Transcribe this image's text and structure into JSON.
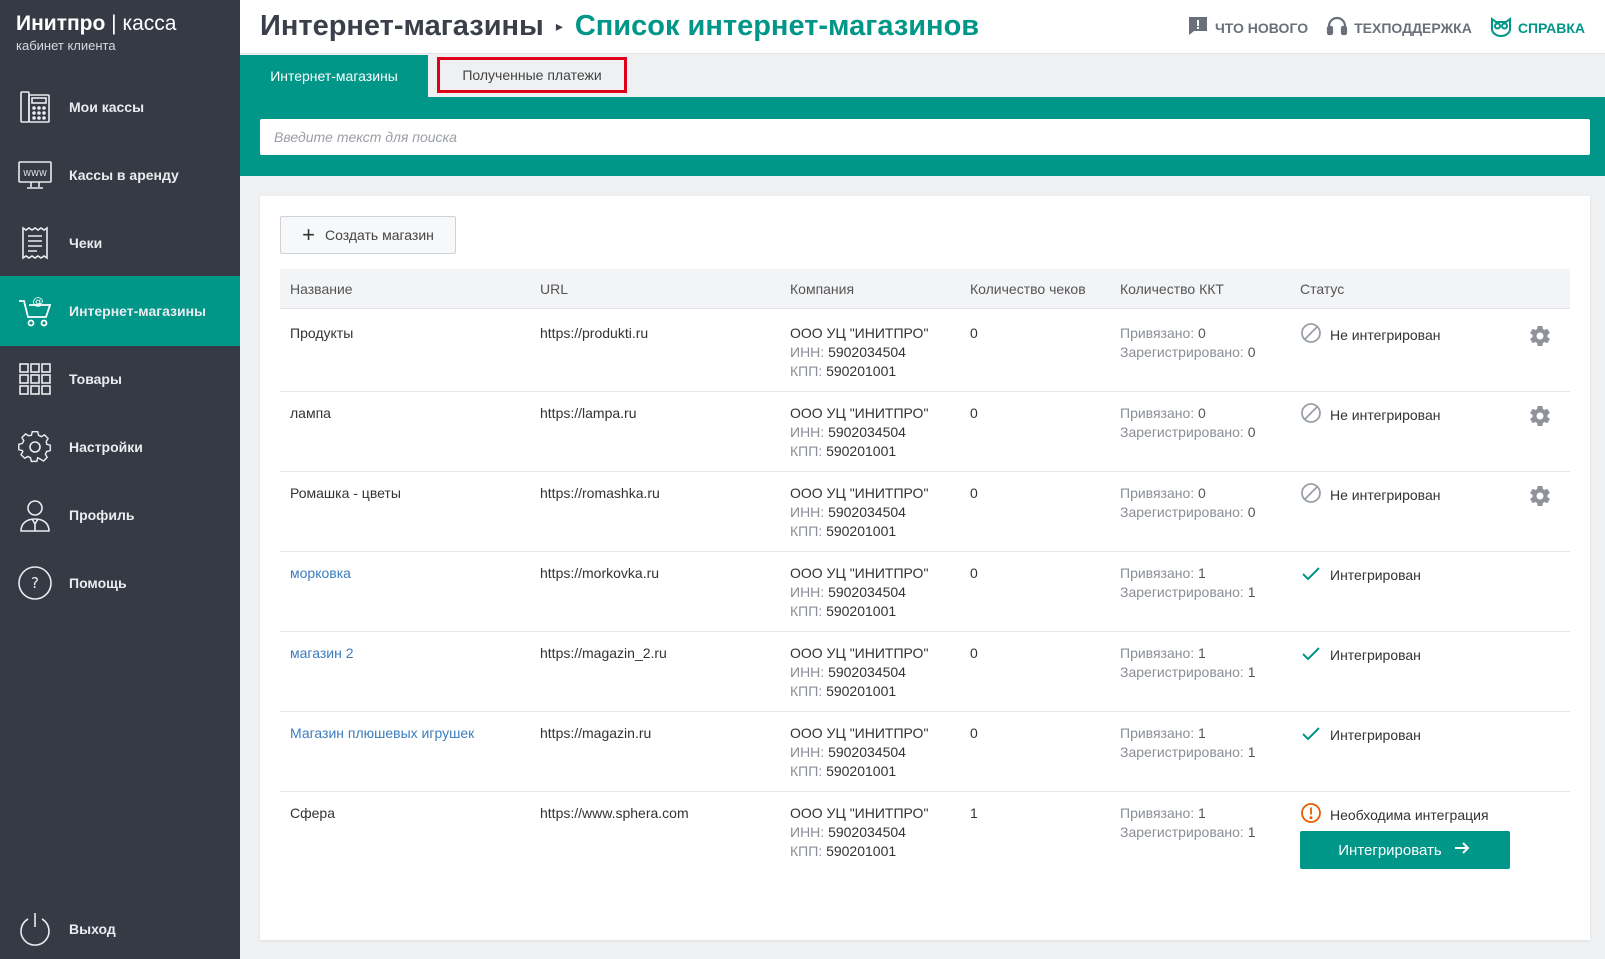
{
  "brand": {
    "name": "Инитпро",
    "separator": "|",
    "product": "касса",
    "subtitle": "кабинет клиента"
  },
  "sidebar": {
    "items": [
      {
        "label": "Мои кассы",
        "icon": "cash-register-icon"
      },
      {
        "label": "Кассы в аренду",
        "icon": "www-monitor-icon"
      },
      {
        "label": "Чеки",
        "icon": "receipt-icon"
      },
      {
        "label": "Интернет-магазины",
        "icon": "shopping-cart-icon",
        "active": true
      },
      {
        "label": "Товары",
        "icon": "grid-icon"
      },
      {
        "label": "Настройки",
        "icon": "gear-icon"
      },
      {
        "label": "Профиль",
        "icon": "user-icon"
      },
      {
        "label": "Помощь",
        "icon": "question-icon"
      }
    ],
    "logout": {
      "label": "Выход",
      "icon": "power-icon"
    }
  },
  "header": {
    "breadcrumb_parent": "Интернет-магазины",
    "breadcrumb_separator": "›",
    "breadcrumb_current": "Список интернет-магазинов",
    "links": {
      "news": "ЧТО НОВОГО",
      "support": "ТЕХПОДДЕРЖКА",
      "help": "СПРАВКА"
    }
  },
  "tabs": [
    {
      "label": "Интернет-магазины",
      "active": true
    },
    {
      "label": "Полученные платежи",
      "active": false
    }
  ],
  "search": {
    "placeholder": "Введите текст для поиска",
    "value": ""
  },
  "create_button": "Создать магазин",
  "table": {
    "columns": [
      "Название",
      "URL",
      "Компания",
      "Количество чеков",
      "Количество ККТ",
      "Статус"
    ],
    "labels": {
      "inn": "ИНН:",
      "kpp": "КПП:",
      "bound": "Привязано:",
      "registered": "Зарегистрировано:"
    },
    "rows": [
      {
        "name": "Продукты",
        "link": false,
        "url": "https://produkti.ru",
        "company": "ООО УЦ \"ИНИТПРО\"",
        "inn": "5902034504",
        "kpp": "590201001",
        "checks": "0",
        "bound": "0",
        "registered": "0",
        "status": "Не интегрирован",
        "status_type": "not",
        "gear": true
      },
      {
        "name": "лампа",
        "link": false,
        "url": "https://lampa.ru",
        "company": "ООО УЦ \"ИНИТПРО\"",
        "inn": "5902034504",
        "kpp": "590201001",
        "checks": "0",
        "bound": "0",
        "registered": "0",
        "status": "Не интегрирован",
        "status_type": "not",
        "gear": true
      },
      {
        "name": "Ромашка - цветы",
        "link": false,
        "url": "https://romashka.ru",
        "company": "ООО УЦ \"ИНИТПРО\"",
        "inn": "5902034504",
        "kpp": "590201001",
        "checks": "0",
        "bound": "0",
        "registered": "0",
        "status": "Не интегрирован",
        "status_type": "not",
        "gear": true
      },
      {
        "name": "морковка",
        "link": true,
        "url": "https://morkovka.ru",
        "company": "ООО УЦ \"ИНИТПРО\"",
        "inn": "5902034504",
        "kpp": "590201001",
        "checks": "0",
        "bound": "1",
        "registered": "1",
        "status": "Интегрирован",
        "status_type": "ok",
        "gear": false
      },
      {
        "name": "магазин 2",
        "link": true,
        "url": "https://magazin_2.ru",
        "company": "ООО УЦ \"ИНИТПРО\"",
        "inn": "5902034504",
        "kpp": "590201001",
        "checks": "0",
        "bound": "1",
        "registered": "1",
        "status": "Интегрирован",
        "status_type": "ok",
        "gear": false
      },
      {
        "name": "Магазин плюшевых игрушек",
        "link": true,
        "url": "https://magazin.ru",
        "company": "ООО УЦ \"ИНИТПРО\"",
        "inn": "5902034504",
        "kpp": "590201001",
        "checks": "0",
        "bound": "1",
        "registered": "1",
        "status": "Интегрирован",
        "status_type": "ok",
        "gear": false
      },
      {
        "name": "Сфера",
        "link": false,
        "url": "https://www.sphera.com",
        "company": "ООО УЦ \"ИНИТПРО\"",
        "inn": "5902034504",
        "kpp": "590201001",
        "checks": "1",
        "bound": "1",
        "registered": "1",
        "status": "Необходима интеграция",
        "status_type": "warn",
        "gear": false
      }
    ],
    "integrate_button": "Интегрировать"
  },
  "colors": {
    "accent": "#009688",
    "sidebar": "#363a45",
    "link": "#3d7dbf",
    "warning": "#e65c00",
    "highlight_border": "#e0001a"
  }
}
